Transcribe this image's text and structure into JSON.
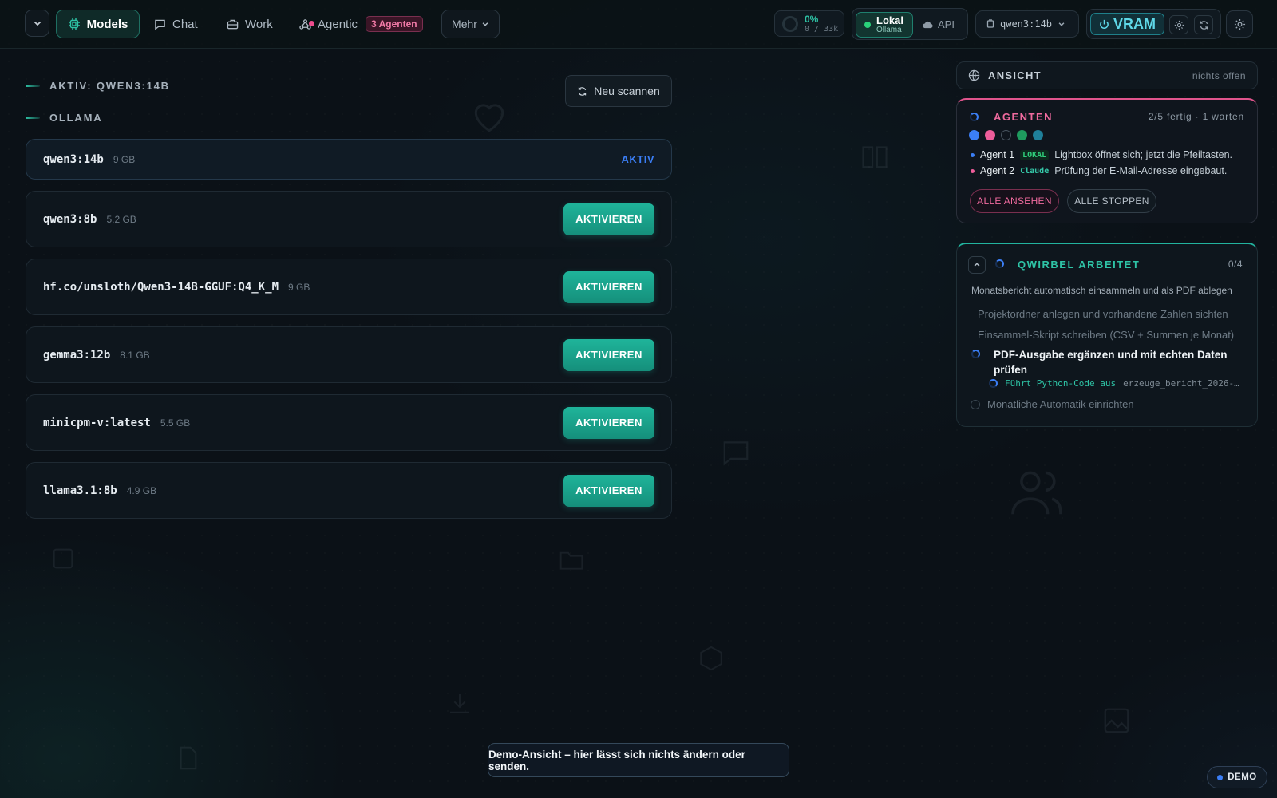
{
  "header": {
    "tabs": [
      {
        "label": "Models",
        "icon": "chip-icon",
        "active": true
      },
      {
        "label": "Chat",
        "icon": "chat-icon"
      },
      {
        "label": "Work",
        "icon": "briefcase-icon"
      },
      {
        "label": "Agentic",
        "icon": "agents-icon",
        "badge": "3 Agenten"
      }
    ],
    "more_label": "Mehr",
    "context": {
      "percent": "0%",
      "tokens": "0 / 33k"
    },
    "mode": {
      "local_label": "Lokal",
      "local_sub": "Ollama",
      "api_label": "API"
    },
    "model_select": "qwen3:14b",
    "vram_label": "VRAM"
  },
  "models_section": {
    "active_heading": "AKTIV: QWEN3:14B",
    "provider_heading": "OLLAMA",
    "rescan_label": "Neu scannen",
    "active_tag": "AKTIV",
    "activate_label": "AKTIVIEREN",
    "models": [
      {
        "name": "qwen3:14b",
        "size": "9 GB",
        "active": true
      },
      {
        "name": "qwen3:8b",
        "size": "5.2 GB"
      },
      {
        "name": "hf.co/unsloth/Qwen3-14B-GGUF:Q4_K_M",
        "size": "9 GB"
      },
      {
        "name": "gemma3:12b",
        "size": "8.1 GB"
      },
      {
        "name": "minicpm-v:latest",
        "size": "5.5 GB"
      },
      {
        "name": "llama3.1:8b",
        "size": "4.9 GB"
      }
    ]
  },
  "view_panel": {
    "title": "ANSICHT",
    "status": "nichts offen"
  },
  "agents_panel": {
    "title": "AGENTEN",
    "status": "2/5 fertig · 1 warten",
    "dot_colors": [
      "#3b7ef5",
      "#ee5d9a",
      "transparent",
      "#1e9a5e",
      "#1f7f9a"
    ],
    "agents": [
      {
        "name": "Agent 1",
        "tag": "LOKAL",
        "text": "Lightbox öffnet sich; jetzt die Pfeiltasten.",
        "color": "#3b7ef5"
      },
      {
        "name": "Agent 2",
        "tag": "Claude",
        "text": "Prüfung der E-Mail-Adresse eingebaut.",
        "color": "#ee5d9a"
      }
    ],
    "view_all_label": "ALLE ANSEHEN",
    "stop_all_label": "ALLE STOPPEN"
  },
  "qwirbel_panel": {
    "title": "QWIRBEL ARBEITET",
    "count": "0/4",
    "description": "Monatsbericht automatisch einsammeln und als PDF ablegen",
    "steps": [
      "Projektordner anlegen und vorhandene Zahlen sichten",
      "Einsammel-Skript schreiben (CSV + Summen je Monat)",
      "PDF-Ausgabe ergänzen und mit echten Daten prüfen",
      "Monatliche Automatik einrichten"
    ],
    "current_action": "Führt Python-Code aus",
    "current_file": "erzeuge_bericht_2026-…"
  },
  "toast": "Demo-Ansicht – hier lässt sich nichts ändern oder senden.",
  "demo_badge": "DEMO",
  "colors": {
    "accent": "#2ec4a6",
    "agent_pink": "#ee5d9a",
    "active_blue": "#3b7ef5",
    "background": "#0b1117"
  }
}
